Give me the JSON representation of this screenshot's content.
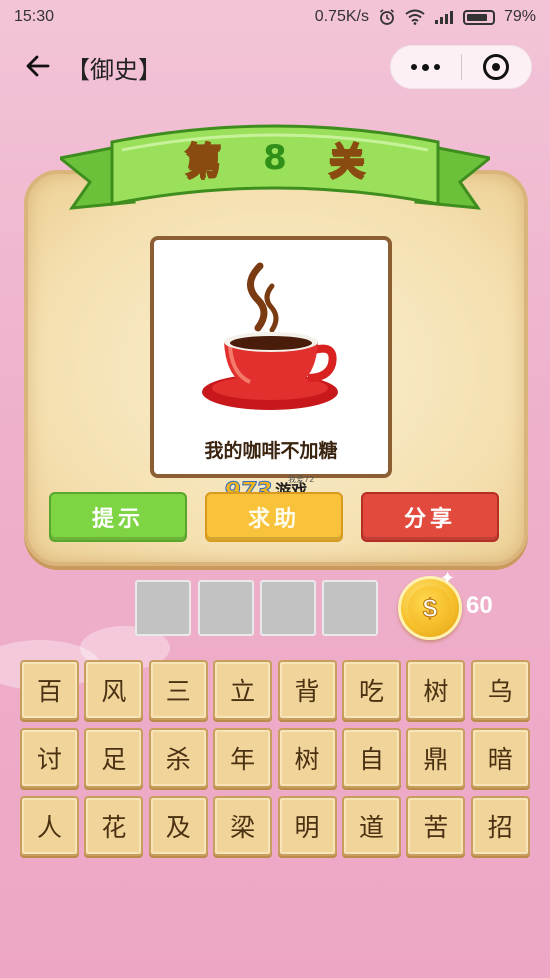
{
  "status_bar": {
    "time": "15:30",
    "network_speed": "0.75K/s",
    "battery": "79%"
  },
  "nav": {
    "title": "【御史】"
  },
  "level": {
    "prefix": "第",
    "number": "8",
    "suffix": "关"
  },
  "puzzle": {
    "caption": "我的咖啡不加糖"
  },
  "watermark": {
    "logo": "973",
    "text": "游戏",
    "small": "我爱72"
  },
  "buttons": {
    "hint": "提示",
    "help": "求助",
    "share": "分享"
  },
  "coins": {
    "count": "60",
    "symbol": "$"
  },
  "answer_slots": [
    "",
    "",
    "",
    ""
  ],
  "characters": [
    "百",
    "风",
    "三",
    "立",
    "背",
    "吃",
    "树",
    "乌",
    "讨",
    "足",
    "杀",
    "年",
    "树",
    "自",
    "鼎",
    "暗",
    "人",
    "花",
    "及",
    "梁",
    "明",
    "道",
    "苦",
    "招"
  ],
  "colors": {
    "hint_button": "#7ed442",
    "help_button": "#f8c33a",
    "share_button": "#e24a3e",
    "ribbon_green": "#8ddc4a",
    "tile": "#f1d49a"
  }
}
